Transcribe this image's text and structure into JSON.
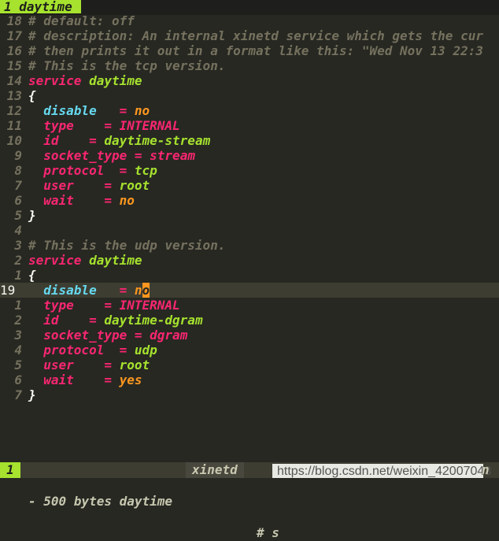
{
  "tabline": {
    "active_tab": "1 daytime"
  },
  "lines": [
    {
      "num": "18",
      "segs": [
        {
          "c": "c-com",
          "t": "# default: off"
        }
      ]
    },
    {
      "num": "17",
      "segs": [
        {
          "c": "c-com",
          "t": "# description: An internal xinetd service which gets the cur"
        }
      ]
    },
    {
      "num": "16",
      "segs": [
        {
          "c": "c-com",
          "t": "# then prints it out in a format like this: \"Wed Nov 13 22:3"
        }
      ]
    },
    {
      "num": "15",
      "segs": [
        {
          "c": "c-com",
          "t": "# This is the tcp version."
        }
      ]
    },
    {
      "num": "14",
      "segs": [
        {
          "c": "c-kw",
          "t": "service"
        },
        {
          "c": "c-brace",
          "t": " "
        },
        {
          "c": "c-name",
          "t": "daytime"
        }
      ]
    },
    {
      "num": "13",
      "segs": [
        {
          "c": "c-brace",
          "t": "{"
        }
      ]
    },
    {
      "num": "12",
      "segs": [
        {
          "c": "c-brace",
          "t": "  "
        },
        {
          "c": "c-key-b",
          "t": "disable"
        },
        {
          "c": "c-brace",
          "t": "   "
        },
        {
          "c": "c-eq",
          "t": "="
        },
        {
          "c": "c-brace",
          "t": " "
        },
        {
          "c": "c-val-o",
          "t": "no"
        }
      ]
    },
    {
      "num": "11",
      "segs": [
        {
          "c": "c-brace",
          "t": "  "
        },
        {
          "c": "c-key",
          "t": "type"
        },
        {
          "c": "c-brace",
          "t": "    "
        },
        {
          "c": "c-eq",
          "t": "="
        },
        {
          "c": "c-brace",
          "t": " "
        },
        {
          "c": "c-val-p",
          "t": "INTERNAL"
        }
      ]
    },
    {
      "num": "10",
      "segs": [
        {
          "c": "c-brace",
          "t": "  "
        },
        {
          "c": "c-key",
          "t": "id"
        },
        {
          "c": "c-brace",
          "t": "    "
        },
        {
          "c": "c-eq",
          "t": "="
        },
        {
          "c": "c-brace",
          "t": " "
        },
        {
          "c": "c-val-g",
          "t": "daytime-stream"
        }
      ]
    },
    {
      "num": "9",
      "segs": [
        {
          "c": "c-brace",
          "t": "  "
        },
        {
          "c": "c-key",
          "t": "socket_type"
        },
        {
          "c": "c-brace",
          "t": " "
        },
        {
          "c": "c-eq",
          "t": "="
        },
        {
          "c": "c-brace",
          "t": " "
        },
        {
          "c": "c-val-p",
          "t": "stream"
        }
      ]
    },
    {
      "num": "8",
      "segs": [
        {
          "c": "c-brace",
          "t": "  "
        },
        {
          "c": "c-key",
          "t": "protocol"
        },
        {
          "c": "c-brace",
          "t": "  "
        },
        {
          "c": "c-eq",
          "t": "="
        },
        {
          "c": "c-brace",
          "t": " "
        },
        {
          "c": "c-val-g",
          "t": "tcp"
        }
      ]
    },
    {
      "num": "7",
      "segs": [
        {
          "c": "c-brace",
          "t": "  "
        },
        {
          "c": "c-key",
          "t": "user"
        },
        {
          "c": "c-brace",
          "t": "    "
        },
        {
          "c": "c-eq",
          "t": "="
        },
        {
          "c": "c-brace",
          "t": " "
        },
        {
          "c": "c-val-g",
          "t": "root"
        }
      ]
    },
    {
      "num": "6",
      "segs": [
        {
          "c": "c-brace",
          "t": "  "
        },
        {
          "c": "c-key",
          "t": "wait"
        },
        {
          "c": "c-brace",
          "t": "    "
        },
        {
          "c": "c-eq",
          "t": "="
        },
        {
          "c": "c-brace",
          "t": " "
        },
        {
          "c": "c-val-o",
          "t": "no"
        }
      ]
    },
    {
      "num": "5",
      "segs": [
        {
          "c": "c-brace",
          "t": "}"
        }
      ]
    },
    {
      "num": "4",
      "segs": []
    },
    {
      "num": "3",
      "segs": [
        {
          "c": "c-com",
          "t": "# This is the udp version."
        }
      ]
    },
    {
      "num": "2",
      "segs": [
        {
          "c": "c-kw",
          "t": "service"
        },
        {
          "c": "c-brace",
          "t": " "
        },
        {
          "c": "c-name",
          "t": "daytime"
        }
      ]
    },
    {
      "num": "1",
      "segs": [
        {
          "c": "c-brace",
          "t": "{"
        }
      ]
    },
    {
      "num": "19",
      "current": true,
      "segs": [
        {
          "c": "c-brace",
          "t": "  "
        },
        {
          "c": "c-key-b",
          "t": "disable"
        },
        {
          "c": "c-brace",
          "t": "   "
        },
        {
          "c": "c-eq",
          "t": "="
        },
        {
          "c": "c-brace",
          "t": " "
        },
        {
          "c": "c-val-o",
          "t": "n"
        },
        {
          "c": "cursor",
          "t": "o"
        }
      ]
    },
    {
      "num": "1",
      "segs": [
        {
          "c": "c-brace",
          "t": "  "
        },
        {
          "c": "c-key",
          "t": "type"
        },
        {
          "c": "c-brace",
          "t": "    "
        },
        {
          "c": "c-eq",
          "t": "="
        },
        {
          "c": "c-brace",
          "t": " "
        },
        {
          "c": "c-val-p",
          "t": "INTERNAL"
        }
      ]
    },
    {
      "num": "2",
      "segs": [
        {
          "c": "c-brace",
          "t": "  "
        },
        {
          "c": "c-key",
          "t": "id"
        },
        {
          "c": "c-brace",
          "t": "    "
        },
        {
          "c": "c-eq",
          "t": "="
        },
        {
          "c": "c-brace",
          "t": " "
        },
        {
          "c": "c-val-g",
          "t": "daytime-dgram"
        }
      ]
    },
    {
      "num": "3",
      "segs": [
        {
          "c": "c-brace",
          "t": "  "
        },
        {
          "c": "c-key",
          "t": "socket_type"
        },
        {
          "c": "c-brace",
          "t": " "
        },
        {
          "c": "c-eq",
          "t": "="
        },
        {
          "c": "c-brace",
          "t": " "
        },
        {
          "c": "c-val-p",
          "t": "dgram"
        }
      ]
    },
    {
      "num": "4",
      "segs": [
        {
          "c": "c-brace",
          "t": "  "
        },
        {
          "c": "c-key",
          "t": "protocol"
        },
        {
          "c": "c-brace",
          "t": "  "
        },
        {
          "c": "c-eq",
          "t": "="
        },
        {
          "c": "c-brace",
          "t": " "
        },
        {
          "c": "c-val-g",
          "t": "udp"
        }
      ]
    },
    {
      "num": "5",
      "segs": [
        {
          "c": "c-brace",
          "t": "  "
        },
        {
          "c": "c-key",
          "t": "user"
        },
        {
          "c": "c-brace",
          "t": "    "
        },
        {
          "c": "c-eq",
          "t": "="
        },
        {
          "c": "c-brace",
          "t": " "
        },
        {
          "c": "c-val-g",
          "t": "root"
        }
      ]
    },
    {
      "num": "6",
      "segs": [
        {
          "c": "c-brace",
          "t": "  "
        },
        {
          "c": "c-key",
          "t": "wait"
        },
        {
          "c": "c-brace",
          "t": "    "
        },
        {
          "c": "c-eq",
          "t": "="
        },
        {
          "c": "c-brace",
          "t": " "
        },
        {
          "c": "c-val-o",
          "t": "yes"
        }
      ]
    },
    {
      "num": "7",
      "segs": [
        {
          "c": "c-brace",
          "t": "}"
        }
      ]
    }
  ],
  "statusbar": {
    "mode": "1",
    "info": "- 500 bytes daytime",
    "filetype": "xinetd",
    "rest": "# s",
    "tail": "n"
  },
  "watermark": {
    "text": "https://blog.csdn.net/weixin_42007043"
  },
  "colors": {
    "background": "#272822",
    "comment": "#75715e",
    "keyword": "#f92672",
    "name": "#a6e22e",
    "key_blue": "#66d9ef",
    "orange": "#fd971f"
  }
}
